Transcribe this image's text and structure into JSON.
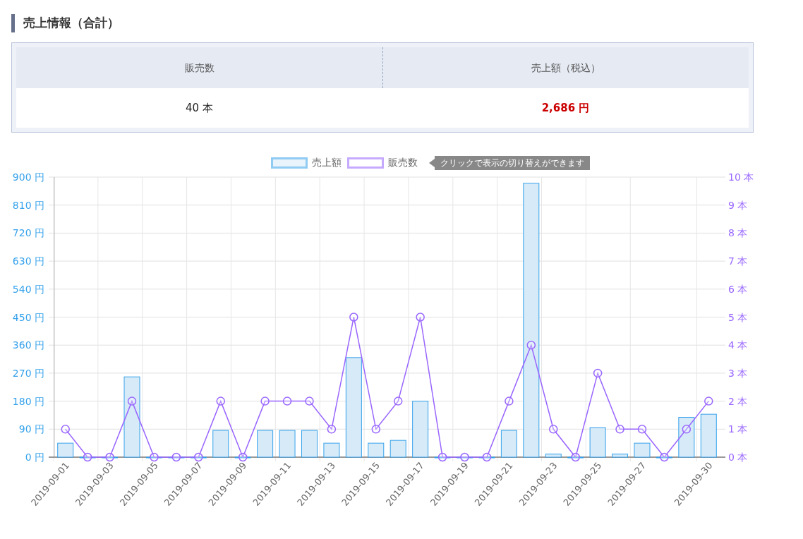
{
  "section_title": "売上情報（合計）",
  "summary": {
    "columns": [
      {
        "header": "販売数",
        "value": "40 本",
        "highlight": false
      },
      {
        "header": "売上額（税込）",
        "value": "2,686 円",
        "highlight": true
      }
    ]
  },
  "legend_hint": "クリックで表示の切り替えができます",
  "chart_data": {
    "type": "bar",
    "categories": [
      "2019-09-01",
      null,
      "2019-09-03",
      null,
      "2019-09-05",
      null,
      "2019-09-07",
      null,
      "2019-09-09",
      null,
      "2019-09-11",
      null,
      "2019-09-13",
      null,
      "2019-09-15",
      null,
      "2019-09-17",
      null,
      "2019-09-19",
      null,
      "2019-09-21",
      null,
      "2019-09-23",
      null,
      "2019-09-25",
      null,
      "2019-09-27",
      null,
      null,
      "2019-09-30"
    ],
    "stacked": false,
    "grid": true,
    "series": [
      {
        "name": "売上額",
        "color": "#36a2eb",
        "values": [
          45,
          0,
          0,
          258,
          0,
          0,
          0,
          86,
          0,
          86,
          86,
          86,
          45,
          320,
          45,
          54,
          180,
          0,
          0,
          0,
          86,
          880,
          10,
          0,
          95,
          10,
          45,
          0,
          128,
          138
        ]
      },
      {
        "name": "販売数",
        "type": "line",
        "axis": "y2",
        "marker": "circle",
        "color": "#9966ff",
        "values": [
          1,
          0,
          0,
          2,
          0,
          0,
          0,
          2,
          0,
          2,
          2,
          2,
          1,
          5,
          1,
          2,
          5,
          0,
          0,
          0,
          2,
          4,
          1,
          0,
          3,
          1,
          1,
          0,
          1,
          2
        ]
      }
    ],
    "ylim": [
      0,
      900
    ],
    "yticks": [
      {
        "value": 0,
        "label": "0 円"
      },
      {
        "value": 90,
        "label": "90 円"
      },
      {
        "value": 180,
        "label": "180 円"
      },
      {
        "value": 270,
        "label": "270 円"
      },
      {
        "value": 360,
        "label": "360 円"
      },
      {
        "value": 450,
        "label": "450 円"
      },
      {
        "value": 540,
        "label": "540 円"
      },
      {
        "value": 630,
        "label": "630 円"
      },
      {
        "value": 720,
        "label": "720 円"
      },
      {
        "value": 810,
        "label": "810 円"
      },
      {
        "value": 900,
        "label": "900 円"
      }
    ],
    "y2lim": [
      0,
      10
    ],
    "y2ticks": [
      {
        "value": 0,
        "label": "0 本"
      },
      {
        "value": 1,
        "label": "1 本"
      },
      {
        "value": 2,
        "label": "2 本"
      },
      {
        "value": 3,
        "label": "3 本"
      },
      {
        "value": 4,
        "label": "4 本"
      },
      {
        "value": 5,
        "label": "5 本"
      },
      {
        "value": 6,
        "label": "6 本"
      },
      {
        "value": 7,
        "label": "7 本"
      },
      {
        "value": 8,
        "label": "8 本"
      },
      {
        "value": 9,
        "label": "9 本"
      },
      {
        "value": 10,
        "label": "10 本"
      }
    ]
  }
}
